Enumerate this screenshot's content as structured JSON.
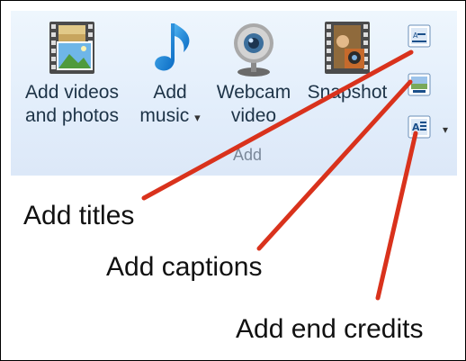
{
  "ribbon": {
    "group_label": "Add",
    "buttons": [
      {
        "line1": "Add videos",
        "line2": "and photos",
        "icon": "film-photo-icon"
      },
      {
        "line1": "Add",
        "line2": "music",
        "icon": "music-note-icon",
        "dropdown": "▾"
      },
      {
        "line1": "Webcam",
        "line2": "video",
        "icon": "webcam-icon"
      },
      {
        "line1": "Snapshot",
        "line2": "",
        "icon": "snapshot-film-icon"
      }
    ],
    "small_buttons": [
      {
        "icon": "add-title-icon"
      },
      {
        "icon": "add-caption-icon"
      },
      {
        "icon": "add-credits-icon",
        "dropdown": "▾"
      }
    ]
  },
  "annotations": {
    "titles": "Add titles",
    "captions": "Add captions",
    "credits": "Add end credits"
  },
  "colors": {
    "annotation_line": "#d9321c",
    "ribbon_bg": "#e3eefb"
  }
}
